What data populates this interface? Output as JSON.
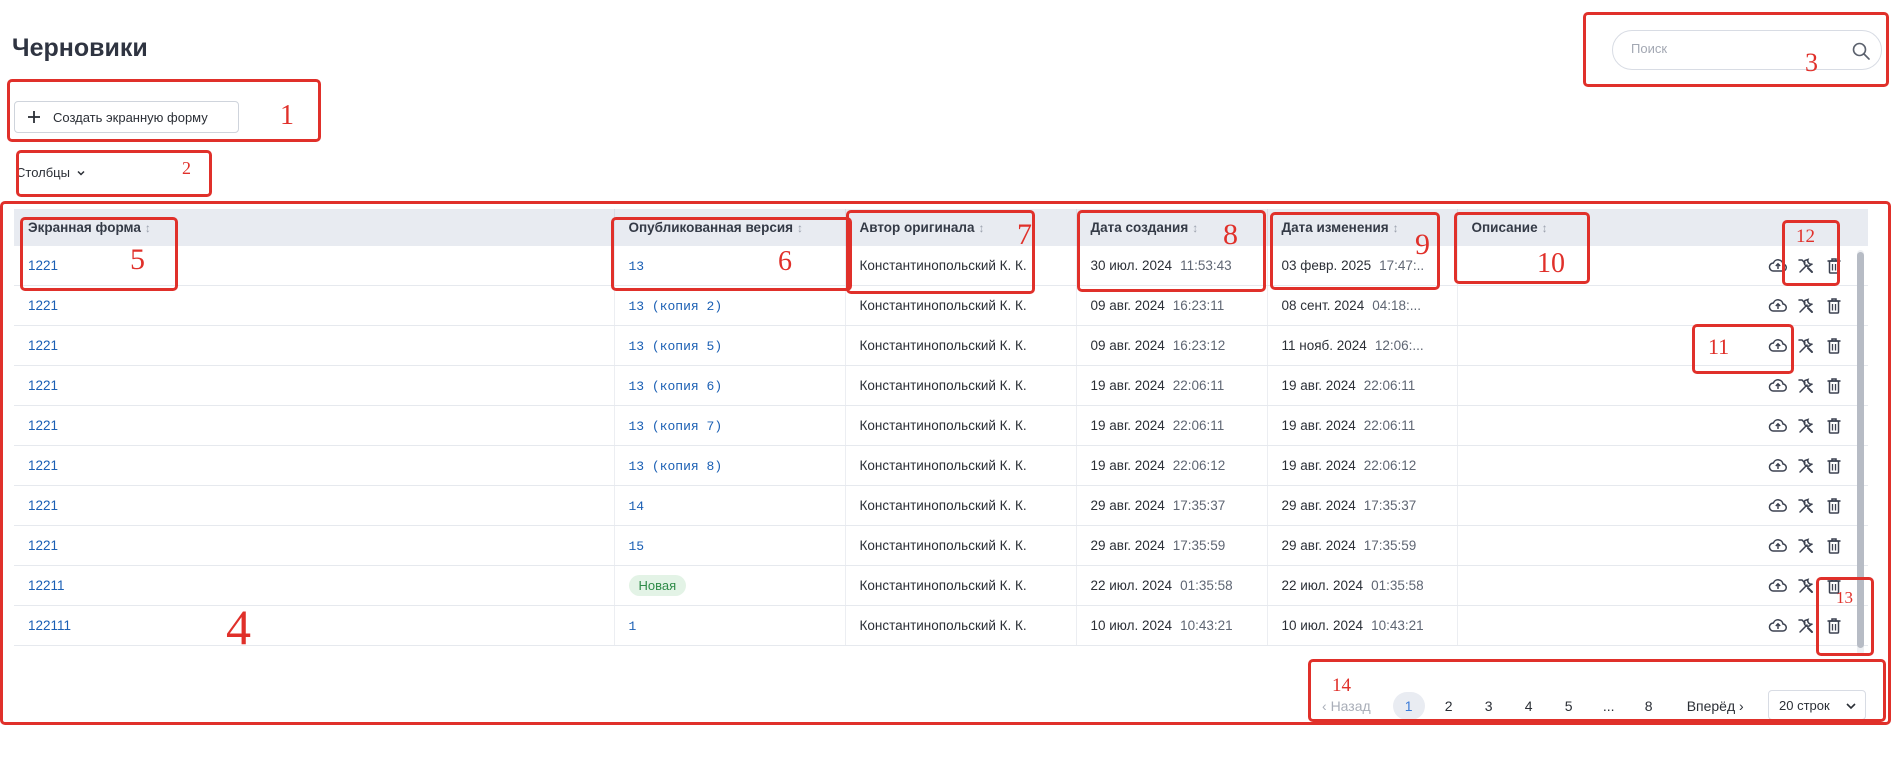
{
  "page": {
    "title": "Черновики"
  },
  "search": {
    "placeholder": "Поиск",
    "icon": "search-icon"
  },
  "toolbar": {
    "create_label": "Создать экранную форму",
    "columns_label": "Столбцы"
  },
  "table": {
    "columns": [
      "Экранная форма",
      "Опубликованная версия",
      "Автор оригинала",
      "Дата создания",
      "Дата изменения",
      "Описание"
    ],
    "rows": [
      {
        "form": "1221",
        "version": "13",
        "author": "Константинопольский К. К.",
        "created_date": "30 июл. 2024",
        "created_time": "11:53:43",
        "modified_date": "03 февр. 2025",
        "modified_time": "17:47:..",
        "description": ""
      },
      {
        "form": "1221",
        "version": "13 (копия 2)",
        "author": "Константинопольский К. К.",
        "created_date": "09 авг. 2024",
        "created_time": "16:23:11",
        "modified_date": "08 сент. 2024",
        "modified_time": "04:18:...",
        "description": ""
      },
      {
        "form": "1221",
        "version": "13 (копия 5)",
        "author": "Константинопольский К. К.",
        "created_date": "09 авг. 2024",
        "created_time": "16:23:12",
        "modified_date": "11 нояб. 2024",
        "modified_time": "12:06:...",
        "description": ""
      },
      {
        "form": "1221",
        "version": "13 (копия 6)",
        "author": "Константинопольский К. К.",
        "created_date": "19 авг. 2024",
        "created_time": "22:06:11",
        "modified_date": "19 авг. 2024",
        "modified_time": "22:06:11",
        "description": ""
      },
      {
        "form": "1221",
        "version": "13 (копия 7)",
        "author": "Константинопольский К. К.",
        "created_date": "19 авг. 2024",
        "created_time": "22:06:11",
        "modified_date": "19 авг. 2024",
        "modified_time": "22:06:11",
        "description": ""
      },
      {
        "form": "1221",
        "version": "13 (копия 8)",
        "author": "Константинопольский К. К.",
        "created_date": "19 авг. 2024",
        "created_time": "22:06:12",
        "modified_date": "19 авг. 2024",
        "modified_time": "22:06:12",
        "description": ""
      },
      {
        "form": "1221",
        "version": "14",
        "author": "Константинопольский К. К.",
        "created_date": "29 авг. 2024",
        "created_time": "17:35:37",
        "modified_date": "29 авг. 2024",
        "modified_time": "17:35:37",
        "description": ""
      },
      {
        "form": "1221",
        "version": "15",
        "author": "Константинопольский К. К.",
        "created_date": "29 авг. 2024",
        "created_time": "17:35:59",
        "modified_date": "29 авг. 2024",
        "modified_time": "17:35:59",
        "description": ""
      },
      {
        "form": "12211",
        "version": "Новая",
        "version_badge": true,
        "author": "Константинопольский К. К.",
        "created_date": "22 июл. 2024",
        "created_time": "01:35:58",
        "modified_date": "22 июл. 2024",
        "modified_time": "01:35:58",
        "description": ""
      },
      {
        "form": "122111",
        "version": "1",
        "author": "Константинопольский К. К.",
        "created_date": "10 июл. 2024",
        "created_time": "10:43:21",
        "modified_date": "10 июл. 2024",
        "modified_time": "10:43:21",
        "description": ""
      }
    ],
    "row_action_icons": [
      "cloud-upload-icon",
      "wrench-screwdriver-icon",
      "trash-icon"
    ]
  },
  "pagination": {
    "prev_label": "Назад",
    "pages": [
      "1",
      "2",
      "3",
      "4",
      "5",
      "...",
      "8"
    ],
    "current": "1",
    "next_label": "Вперёд",
    "rows_per_page": "20 строк"
  },
  "annotations": {
    "labels": [
      "1",
      "2",
      "3",
      "4",
      "5",
      "6",
      "7",
      "8",
      "9",
      "10",
      "11",
      "12",
      "13",
      "14"
    ],
    "color": "#e0302a"
  },
  "colors": {
    "link": "#1a5fb4",
    "header_bg": "#e8ebf1",
    "badge_bg": "#e3f3e6",
    "badge_text": "#2e8b48"
  }
}
